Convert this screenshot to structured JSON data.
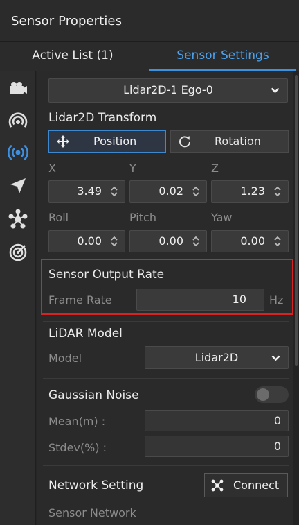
{
  "header": {
    "title": "Sensor Properties"
  },
  "tabs": [
    {
      "label": "Active List  (1)"
    },
    {
      "label": "Sensor Settings"
    }
  ],
  "sensor_select": {
    "value": "Lidar2D-1   Ego-0"
  },
  "transform": {
    "title": "Lidar2D Transform",
    "position_label": "Position",
    "rotation_label": "Rotation",
    "x_label": "X",
    "y_label": "Y",
    "z_label": "Z",
    "x_value": "3.49",
    "y_value": "0.02",
    "z_value": "1.23",
    "roll_label": "Roll",
    "pitch_label": "Pitch",
    "yaw_label": "Yaw",
    "roll_value": "0.00",
    "pitch_value": "0.00",
    "yaw_value": "0.00"
  },
  "output_rate": {
    "title": "Sensor Output Rate",
    "frame_rate_label": "Frame Rate",
    "frame_rate_value": "10",
    "unit": "Hz"
  },
  "lidar_model": {
    "title": "LiDAR Model",
    "model_label": "Model",
    "model_value": "Lidar2D"
  },
  "noise": {
    "title": "Gaussian Noise",
    "enabled": false,
    "mean_label": "Mean(m) :",
    "mean_value": "0",
    "stdev_label": "Stdev(%) :",
    "stdev_value": "0"
  },
  "network": {
    "title": "Network Setting",
    "connect_label": "Connect",
    "sensor_network_label": "Sensor Network"
  },
  "colors": {
    "accent": "#3b93e0",
    "highlight_border": "#d72323",
    "active_icon": "#3d8fe0"
  },
  "sidebar_icons": [
    "camera-icon",
    "radar-icon",
    "lidar-icon",
    "gps-icon",
    "network-icon",
    "sonar-icon"
  ]
}
